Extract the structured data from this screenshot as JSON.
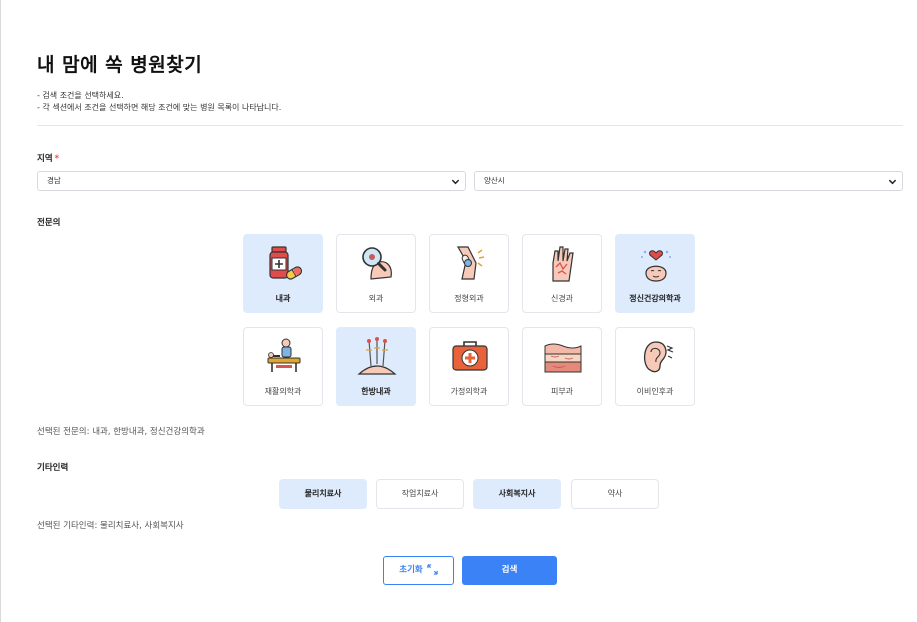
{
  "page": {
    "title": "내 맘에 쏙 병원찾기",
    "desc": [
      "- 검색 조건을 선택하세요.",
      "- 각 섹션에서 조건을 선택하면 해당 조건에 맞는 병원 목록이 나타납니다."
    ]
  },
  "region": {
    "label": "지역",
    "required_mark": "*",
    "province": "경남",
    "city": "양산시"
  },
  "specialty": {
    "label": "전문의",
    "items": [
      {
        "label": "내과",
        "selected": true,
        "icon": "medicine-bottle-icon"
      },
      {
        "label": "외과",
        "selected": false,
        "icon": "magnifier-skin-icon"
      },
      {
        "label": "정형외과",
        "selected": false,
        "icon": "knee-joint-icon"
      },
      {
        "label": "신경과",
        "selected": false,
        "icon": "hand-nerve-icon"
      },
      {
        "label": "정신건강의학과",
        "selected": true,
        "icon": "mental-health-icon"
      },
      {
        "label": "재활의학과",
        "selected": false,
        "icon": "rehab-therapy-icon"
      },
      {
        "label": "한방내과",
        "selected": true,
        "icon": "acupuncture-icon"
      },
      {
        "label": "가정의학과",
        "selected": false,
        "icon": "first-aid-kit-icon"
      },
      {
        "label": "피부과",
        "selected": false,
        "icon": "skin-layers-icon"
      },
      {
        "label": "이비인후과",
        "selected": false,
        "icon": "ear-icon"
      }
    ],
    "selected_text": "선택된 전문의: 내과, 한방내과, 정신건강의학과"
  },
  "staff": {
    "label": "기타인력",
    "items": [
      {
        "label": "물리치료사",
        "selected": true
      },
      {
        "label": "작업치료사",
        "selected": false
      },
      {
        "label": "사회복지사",
        "selected": true
      },
      {
        "label": "약사",
        "selected": false
      }
    ],
    "selected_text": "선택된 기타인력: 물리치료사, 사회복지사"
  },
  "actions": {
    "reset": "초기화",
    "search": "검색"
  },
  "colors": {
    "accent": "#3b82f6",
    "selected_bg": "#deebfc",
    "required": "#e5534b"
  }
}
